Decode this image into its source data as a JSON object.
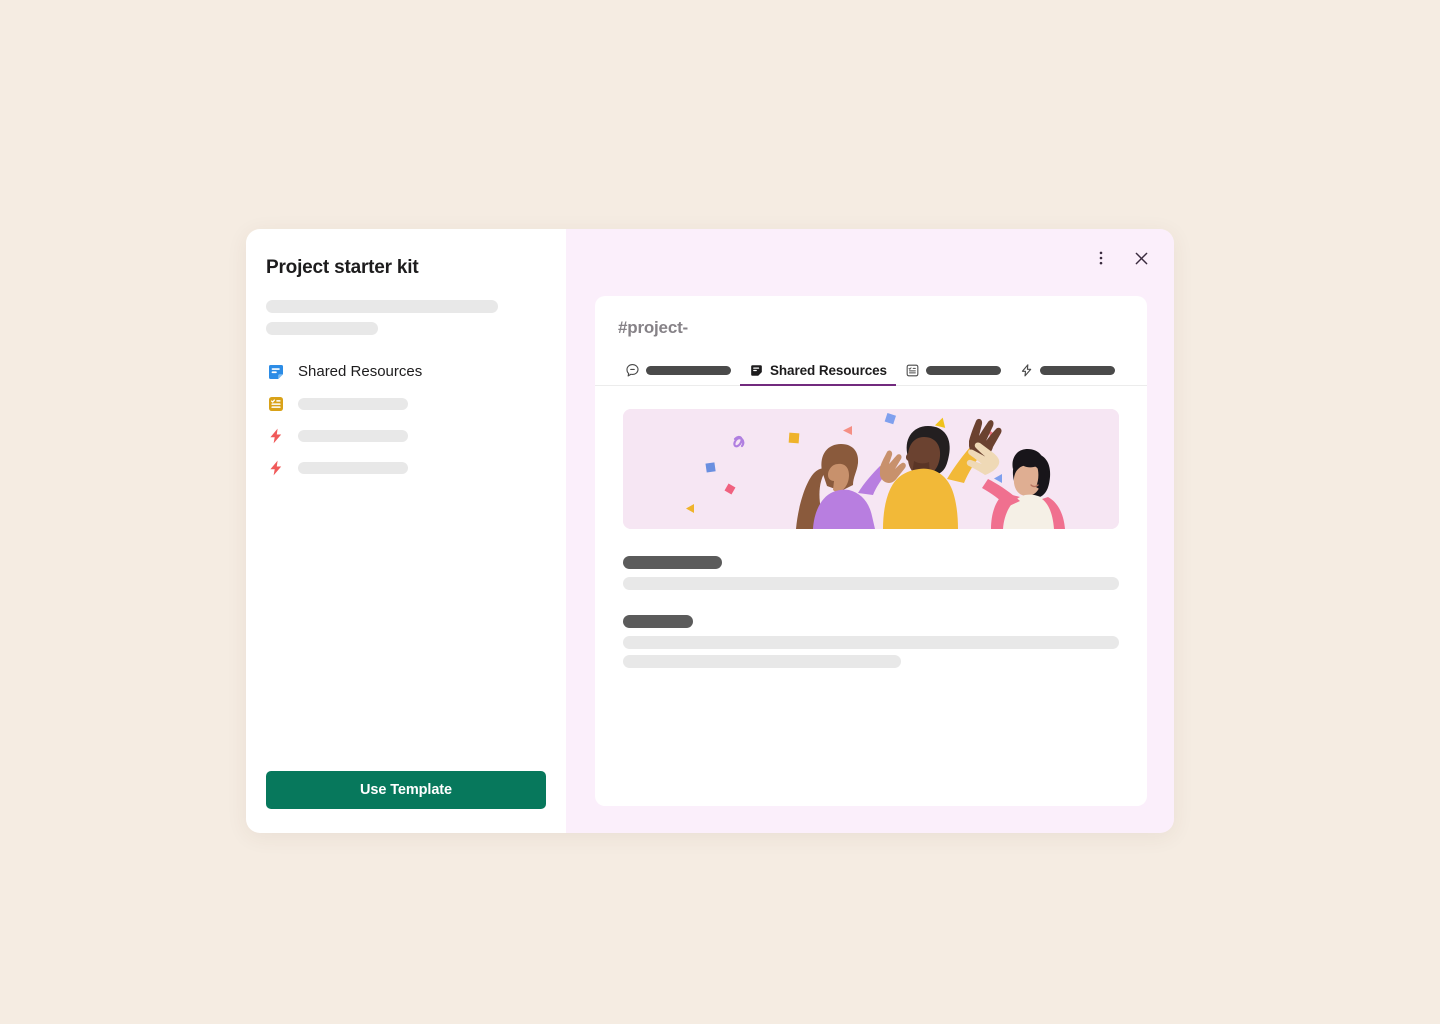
{
  "theme": {
    "page_bg": "#f5ece2",
    "panel_bg": "#ffffff",
    "accent_lavender": "#fbeffb",
    "active_tab_underline": "#722a7e",
    "primary_button": "#07785c",
    "hero_bg": "#f6e6f3"
  },
  "left_panel": {
    "title": "Project starter kit",
    "placeholder_lines": [
      "",
      ""
    ],
    "items": [
      {
        "icon": "canvas-icon",
        "icon_color": "#2c8ce6",
        "label": "Shared Resources",
        "has_label": true
      },
      {
        "icon": "list-icon",
        "icon_color": "#d9a218",
        "label": "",
        "has_label": false
      },
      {
        "icon": "workflow-icon",
        "icon_color": "#f05a5a",
        "label": "",
        "has_label": false
      },
      {
        "icon": "workflow-icon",
        "icon_color": "#f05a5a",
        "label": "",
        "has_label": false
      }
    ],
    "use_template_label": "Use Template"
  },
  "right_panel": {
    "window_controls": [
      {
        "name": "more-options-icon",
        "label": "More options"
      },
      {
        "name": "close-icon",
        "label": "Close"
      }
    ],
    "preview": {
      "channel_name": "#project-",
      "tabs": [
        {
          "icon": "messages-icon",
          "label": "",
          "has_label": false,
          "active": false,
          "skeleton_width": 85
        },
        {
          "icon": "canvas-icon",
          "label": "Shared Resources",
          "has_label": true,
          "active": true,
          "skeleton_width": 0
        },
        {
          "icon": "list-icon",
          "label": "",
          "has_label": false,
          "active": false,
          "skeleton_width": 75
        },
        {
          "icon": "workflow-icon",
          "label": "",
          "has_label": false,
          "active": false,
          "skeleton_width": 75
        }
      ],
      "hero_illustration": {
        "name": "celebration-high-five-illustration",
        "alt": "Three people celebrating with high-fives amid confetti"
      },
      "content_blocks": [
        {
          "heading_width": 99,
          "body_lines": [
            {
              "full": true
            }
          ]
        },
        {
          "heading_width": 70,
          "body_lines": [
            {
              "full": true
            },
            {
              "full": false
            }
          ]
        }
      ]
    }
  }
}
